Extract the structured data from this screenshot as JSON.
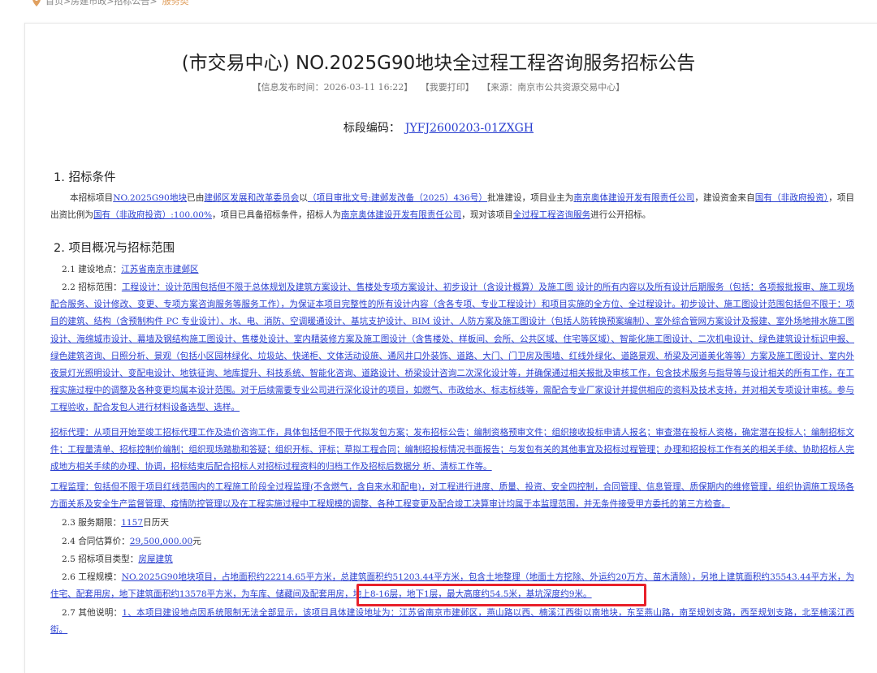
{
  "breadcrumb": {
    "path": "首页>房建市政>招标公告>",
    "current": "服务类"
  },
  "title": "(市交易中心) NO.2025G90地块全过程工程咨询服务招标公告",
  "meta": {
    "publish_time": "【信息发布时间：2026-03-11 16:22】",
    "print": "【我要打印】",
    "source": "【来源：南京市公共资源交易中心】"
  },
  "bid_code": {
    "label": "标段编码：",
    "value": "JYFJ2600203-01ZXGH"
  },
  "section1": {
    "heading": "1.  招标条件",
    "p_t1": "本招标项目",
    "p_l1": "NO.2025G90地块",
    "p_t2": "已由",
    "p_l2": "建邺区发展和改革委员会",
    "p_t3": "以",
    "p_l3": "（项目审批文号:建邺发改备（2025）436号）",
    "p_t4": "批准建设，项目业主为",
    "p_l4": "南京奥体建设开发有限责任公司",
    "p_t5": "，建设资金来自",
    "p_l5": "国有（非政府投资）",
    "p_t6": "，项目出资比例为",
    "p_l6": "国有（非政府投资）:100.00%",
    "p_t7": "，项目已具备招标条件，招标人为",
    "p_l7": "南京奥体建设开发有限责任公司",
    "p_t8": "，现对该项目",
    "p_l8": "全过程工程咨询服务",
    "p_t9": "进行公开招标。"
  },
  "section2": {
    "heading": "2.  项目概况与招标范围",
    "location_label": "2.1 建设地点：",
    "location_value": "江苏省南京市建邺区",
    "scope_label": "2.2 招标范围：",
    "scope_design": "工程设计：设计范围包括但不限于总体规划及建筑方案设计、售楼处专项方案设计、初步设计（含设计概算）及施工图  设计的所有内容以及所有设计后期服务（包括：各项报批报审、施工现场配合服务、设计修改、变更、专项方案咨询服务等服务工作），为保证本项目完整性的所有设计内容（含各专项、专业工程设计）和项目实施的全方位、全过程设计。初步设计、施工图设计范围包括但不限于：项目的建筑、结构（含预制构件  PC  专业设计）、水、电、消防、空调暖通设计、基坑支护设计、BIM  设计、人防方案及施工图设计（包括人防转换预案编制）、室外综合管网方案设计及报建、室外场地排水施工图设计、海绵城市设计、幕墙及钢结构施工图设计、售楼处设计、室内精装修方案及施工图设计（含售楼处、样板间、会所、公共区域、住宅等区域）、智能化施工图设计、二次机电设计、绿色建筑设计标识申报、绿色建筑咨询、日照分析、景观（包括小区园林绿化、垃圾站、快递柜、文体活动设施、通风井口外装饰、道路、大门、门卫房及围墙、红线外绿化、道路景观、桥梁及河道美化等等）方案及施工图设计、室内外夜景灯光照明设计、变配电设计、地铁征询、地库提升、科技系统、智能化咨询、道路设计、桥梁设计咨询二次深化设计等，并确保通过相关报批及审核工作，包含技术服务与指导等与设计相关的所有工作，在工程实施过程中的调整及各种变更均属本设计范围。对于后续需要专业公司进行深化设计的项目，如燃气、市政给水、标志标线等，需配合专业厂家设计并提供相应的资料及技术支持，并对相关专项设计审核。参与工程验收，配合发包人进行材料设备选型、选样。",
    "scope_agency": "招标代理：从项目开始至竣工招标代理工作及造价咨询工作，具体包括但不限于代拟发包方案；发布招标公告；编制资格预审文件；组织接收投标申请人报名；审查潜在投标人资格，确定潜在投标人；编制招标文件；工程量清单、招标控制价编制；组织现场踏勘和答疑；组织开标、评标；草拟工程合同；编制招投标情况书面报告；与发包有关的其他事宜及招标过程管理；办理和招投标工作有关的相关手续、协助招标人完成地方相关手续的办理、协调，招标结束后配合招标人对招标过程资料的归档工作及招标后数据分  析、清标工作等。",
    "scope_supervision": "工程监理：包括但不限于项目红线范围内的工程施工阶段全过程监理(不含燃气，含自来水和配电)，对工程进行进度、质量、投资、安全四控制，合同管理、信息管理、质保期内的维修管理，组织协调施工现场各方面关系及安全生产监督管理、疫情防控管理以及在工程实施过程中工程规模的调整、各种工程变更及配合竣工决算审计均属于本监理范围，并无条件接受甲方委托的第三方检查。",
    "period_label": "2.3 服务期限：",
    "period_value": "1157",
    "period_unit": "日历天",
    "price_label": "2.4 合同估算价：",
    "price_value": "29,500,000.00",
    "price_unit": "元",
    "type_label": "2.5 招标项目类型：",
    "type_value": "房屋建筑",
    "scale_label": "2.6 工程规模：",
    "scale_value": "NO.2025G90地块项目，占地面积约22214.65平方米，总建筑面积约51203.44平方米，包含土地整理（地面土方挖除、外运约20万方、苗木清除），另地上建筑面积约35543.44平方米，为住宅、配套用房，地下建筑面积约13578平方米，为车库、储藏间及配套用房，地上8-16层，地下1层，最大高度约54.5米，基坑深度约9米。",
    "other_label": "2.7 其他说明：",
    "other_value": "1、本项目建设地点因系统限制无法全部显示，该项目具体建设地址为：江苏省南京市建邺区，燕山路以西、楠溪江西街以南地块，东至燕山路，南至规划支路，西至规划支路，北至楠溪江西街。"
  }
}
